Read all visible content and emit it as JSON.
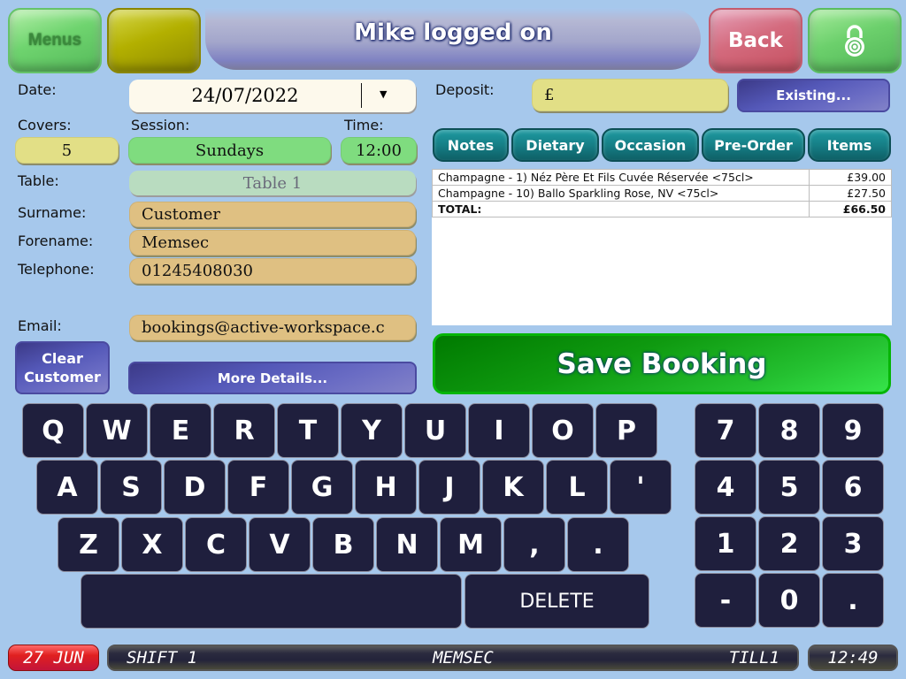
{
  "header": {
    "menus_label": "Menus",
    "title": "Mike logged on",
    "back_label": "Back",
    "lock_icon": "padlock-icon"
  },
  "form": {
    "date_label": "Date:",
    "date_value": "24/07/2022",
    "date_dropdown_icon": "▼",
    "covers_label": "Covers:",
    "covers_value": "5",
    "session_label": "Session:",
    "session_value": "Sundays",
    "time_label": "Time:",
    "time_value": "12:00",
    "table_label": "Table:",
    "table_value": "Table 1",
    "surname_label": "Surname:",
    "surname_value": "Customer",
    "forename_label": "Forename:",
    "forename_value": "Memsec",
    "telephone_label": "Telephone:",
    "telephone_value": "01245408030",
    "email_label": "Email:",
    "email_value": "bookings@active-workspace.c",
    "clear_customer_line1": "Clear",
    "clear_customer_line2": "Customer",
    "more_details_label": "More Details..."
  },
  "deposit": {
    "label": "Deposit:",
    "value": "£",
    "existing_label": "Existing..."
  },
  "tabs": [
    {
      "label": "Notes"
    },
    {
      "label": "Dietary"
    },
    {
      "label": "Occasion"
    },
    {
      "label": "Pre-Order"
    },
    {
      "label": "Items"
    }
  ],
  "items": {
    "rows": [
      {
        "name": "Champagne - 1) Néz Père Et Fils Cuvée Réservée <75cl>",
        "price": "£39.00"
      },
      {
        "name": "Champagne - 10) Ballo Sparkling Rose, NV <75cl>",
        "price": "£27.50"
      }
    ],
    "total_label": "TOTAL:",
    "total_value": "£66.50"
  },
  "save_label": "Save Booking",
  "keyboard": {
    "row1": [
      "Q",
      "W",
      "E",
      "R",
      "T",
      "Y",
      "U",
      "I",
      "O",
      "P"
    ],
    "row2": [
      "A",
      "S",
      "D",
      "F",
      "G",
      "H",
      "J",
      "K",
      "L",
      "'"
    ],
    "row3": [
      "Z",
      "X",
      "C",
      "V",
      "B",
      "N",
      "M",
      ",",
      "."
    ],
    "space_label": "",
    "delete_label": "DELETE",
    "numpad": [
      "7",
      "8",
      "9",
      "4",
      "5",
      "6",
      "1",
      "2",
      "3",
      "-",
      "0",
      "."
    ]
  },
  "status_bar": {
    "date": "27 JUN",
    "shift": "SHIFT 1",
    "user": "MEMSEC",
    "till": "TILL1",
    "time": "12:49"
  }
}
